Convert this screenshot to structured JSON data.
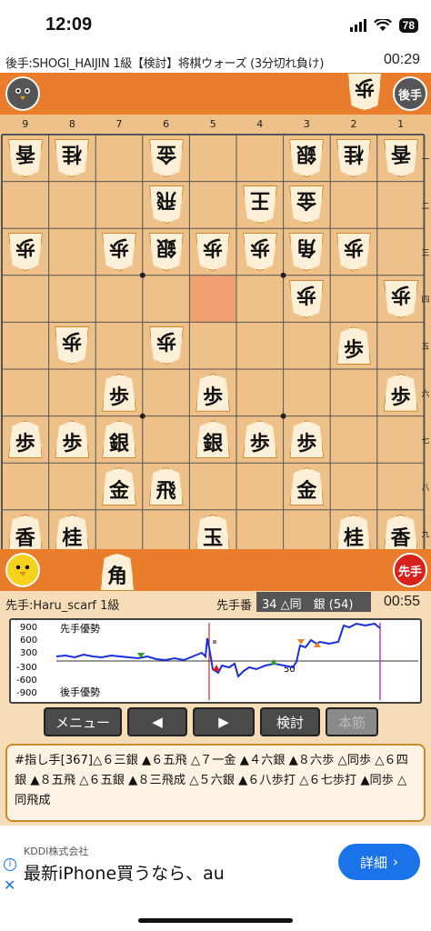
{
  "status_bar": {
    "time": "12:09",
    "battery": "78"
  },
  "gote": {
    "info": "後手:SHOGI_HAIJIN 1級【検討】将棋ウォーズ (3分切れ負け)",
    "clock": "00:29",
    "badge": "後手",
    "hand": [
      "歩"
    ]
  },
  "sente": {
    "info": "先手:Haru_scarf 1級",
    "turn_label": "先手番",
    "last_move": "34 △同　銀 (54)",
    "clock": "00:55",
    "badge": "先手",
    "hand": [
      "角"
    ]
  },
  "board": {
    "files": [
      "9",
      "8",
      "7",
      "6",
      "5",
      "4",
      "3",
      "2",
      "1"
    ],
    "ranks": [
      "一",
      "二",
      "三",
      "四",
      "五",
      "六",
      "七",
      "八",
      "九"
    ],
    "pieces": [
      {
        "f": 0,
        "r": 0,
        "p": "香",
        "side": "gote"
      },
      {
        "f": 1,
        "r": 0,
        "p": "桂",
        "side": "gote"
      },
      {
        "f": 3,
        "r": 0,
        "p": "金",
        "side": "gote"
      },
      {
        "f": 6,
        "r": 0,
        "p": "銀",
        "side": "gote"
      },
      {
        "f": 7,
        "r": 0,
        "p": "桂",
        "side": "gote"
      },
      {
        "f": 8,
        "r": 0,
        "p": "香",
        "side": "gote"
      },
      {
        "f": 3,
        "r": 1,
        "p": "飛",
        "side": "gote"
      },
      {
        "f": 5,
        "r": 1,
        "p": "王",
        "side": "gote"
      },
      {
        "f": 6,
        "r": 1,
        "p": "金",
        "side": "gote"
      },
      {
        "f": 0,
        "r": 2,
        "p": "歩",
        "side": "gote"
      },
      {
        "f": 2,
        "r": 2,
        "p": "歩",
        "side": "gote"
      },
      {
        "f": 3,
        "r": 2,
        "p": "銀",
        "side": "gote"
      },
      {
        "f": 4,
        "r": 2,
        "p": "歩",
        "side": "gote"
      },
      {
        "f": 5,
        "r": 2,
        "p": "歩",
        "side": "gote"
      },
      {
        "f": 6,
        "r": 2,
        "p": "角",
        "side": "gote"
      },
      {
        "f": 7,
        "r": 2,
        "p": "歩",
        "side": "gote"
      },
      {
        "f": 6,
        "r": 3,
        "p": "歩",
        "side": "gote"
      },
      {
        "f": 8,
        "r": 3,
        "p": "歩",
        "side": "gote"
      },
      {
        "f": 1,
        "r": 4,
        "p": "歩",
        "side": "gote"
      },
      {
        "f": 3,
        "r": 4,
        "p": "歩",
        "side": "gote"
      },
      {
        "f": 7,
        "r": 4,
        "p": "歩",
        "side": "sente"
      },
      {
        "f": 2,
        "r": 5,
        "p": "歩",
        "side": "sente"
      },
      {
        "f": 4,
        "r": 5,
        "p": "歩",
        "side": "sente"
      },
      {
        "f": 8,
        "r": 5,
        "p": "歩",
        "side": "sente"
      },
      {
        "f": 0,
        "r": 6,
        "p": "歩",
        "side": "sente"
      },
      {
        "f": 1,
        "r": 6,
        "p": "歩",
        "side": "sente"
      },
      {
        "f": 2,
        "r": 6,
        "p": "銀",
        "side": "sente"
      },
      {
        "f": 4,
        "r": 6,
        "p": "銀",
        "side": "sente"
      },
      {
        "f": 5,
        "r": 6,
        "p": "歩",
        "side": "sente"
      },
      {
        "f": 6,
        "r": 6,
        "p": "歩",
        "side": "sente"
      },
      {
        "f": 2,
        "r": 7,
        "p": "金",
        "side": "sente"
      },
      {
        "f": 3,
        "r": 7,
        "p": "飛",
        "side": "sente"
      },
      {
        "f": 6,
        "r": 7,
        "p": "金",
        "side": "sente"
      },
      {
        "f": 0,
        "r": 8,
        "p": "香",
        "side": "sente"
      },
      {
        "f": 1,
        "r": 8,
        "p": "桂",
        "side": "sente"
      },
      {
        "f": 4,
        "r": 8,
        "p": "玉",
        "side": "sente"
      },
      {
        "f": 7,
        "r": 8,
        "p": "桂",
        "side": "sente"
      },
      {
        "f": 8,
        "r": 8,
        "p": "香",
        "side": "sente"
      }
    ],
    "highlight": {
      "f": 4,
      "r": 3
    }
  },
  "graph": {
    "labels_y": [
      "900",
      "600",
      "300",
      "-300",
      "-600",
      "-900"
    ],
    "sente_adv": "先手優勢",
    "gote_adv": "後手優勢",
    "move_marker": "50"
  },
  "buttons": {
    "menu": "メニュー",
    "prev": "◀",
    "next": "▶",
    "analyze": "検討",
    "mainline": "本筋"
  },
  "moves_text": "#指し手[367]△６三銀 ▲６五飛 △７一金 ▲４六銀 ▲８六歩 △同歩 △６四銀 ▲８五飛 △６五銀 ▲８三飛成 △５六銀 ▲６八歩打 △６七歩打 ▲同歩 △同飛成",
  "ad": {
    "company": "KDDI株式会社",
    "text": "最新iPhone買うなら、au",
    "cta": "詳細"
  },
  "colors": {
    "stand": "#e97d2c",
    "board": "#eec08a",
    "graph_line": "#1a2ee0",
    "sente_badge": "#d8201c",
    "gote_badge": "#555555"
  }
}
